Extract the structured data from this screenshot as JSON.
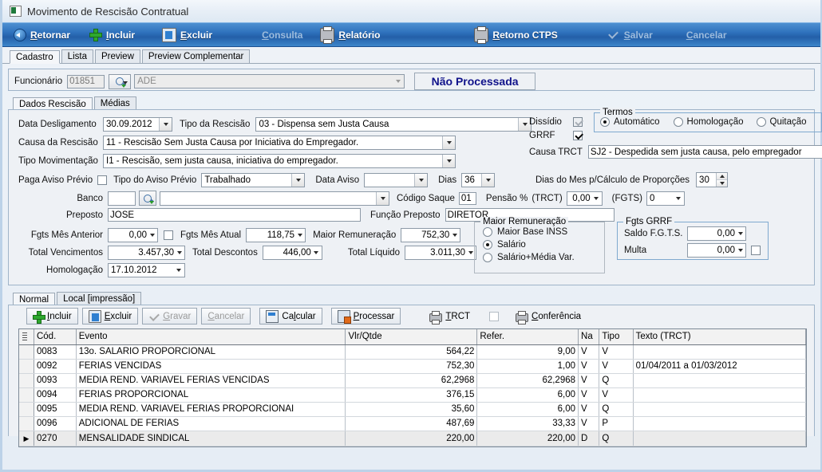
{
  "window": {
    "title": "Movimento de Rescisão Contratual",
    "icon": "window-icon"
  },
  "toolbar": [
    {
      "label": "Retornar",
      "accel": "R",
      "icon": "back-arrow-icon",
      "disabled": false
    },
    {
      "label": "Incluir",
      "accel": "I",
      "icon": "plus-icon",
      "disabled": false
    },
    {
      "label": "Excluir",
      "accel": "E",
      "icon": "delete-clipboard-icon",
      "disabled": false
    },
    {
      "label": "Consulta",
      "accel": "C",
      "icon": "none",
      "disabled": true
    },
    {
      "label": "Relatório",
      "accel": "R",
      "icon": "printer-icon",
      "disabled": false
    },
    {
      "label": "Retorno CTPS",
      "accel": "R",
      "icon": "printer-icon",
      "disabled": false
    },
    {
      "label": "Salvar",
      "accel": "S",
      "icon": "check-icon",
      "disabled": true
    },
    {
      "label": "Cancelar",
      "accel": "C",
      "icon": "none",
      "disabled": true
    }
  ],
  "main_tabs": [
    {
      "label": "Cadastro",
      "active": true
    },
    {
      "label": "Lista",
      "active": false
    },
    {
      "label": "Preview",
      "active": false
    },
    {
      "label": "Preview Complementar",
      "active": false
    }
  ],
  "employee": {
    "label": "Funcionário",
    "code": "01851",
    "name": "ADE",
    "search_icon": "magnifier-icon",
    "status": "Não Processada"
  },
  "sub_tabs": [
    {
      "label": "Dados Rescisão",
      "active": true
    },
    {
      "label": "Médias",
      "active": false
    }
  ],
  "form": {
    "data_desligamento_label": "Data Desligamento",
    "data_desligamento": "30.09.2012",
    "tipo_rescisao_label": "Tipo da Rescisão",
    "tipo_rescisao": "03 - Dispensa sem Justa Causa",
    "causa_rescisao_label": "Causa da Rescisão",
    "causa_rescisao": "11 - Rescisão Sem Justa Causa por Iniciativa do Empregador.",
    "tipo_movimentacao_label": "Tipo Movimentação",
    "tipo_movimentacao": "I1 - Rescisão, sem justa causa, iniciativa do empregador.",
    "paga_aviso_previo_label": "Paga Aviso Prévio",
    "paga_aviso_previo_checked": false,
    "tipo_aviso_previo_label": "Tipo do Aviso Prévio",
    "tipo_aviso_previo": "Trabalhado",
    "data_aviso_label": "Data Aviso",
    "data_aviso": "",
    "dias_label": "Dias",
    "dias": "36",
    "banco_label": "Banco",
    "banco_code": "",
    "banco_name": "",
    "banco_search_icon": "magnifier-icon",
    "codigo_saque_label": "Código Saque",
    "codigo_saque": "01",
    "pensao_label": "Pensão %",
    "pensao_trct_label": "(TRCT)",
    "pensao_trct": "0,00",
    "pensao_fgts_label": "(FGTS)",
    "pensao_fgts": "0",
    "preposto_label": "Preposto",
    "preposto": "JOSE",
    "funcao_preposto_label": "Função Preposto",
    "funcao_preposto": "DIRETOR",
    "fgts_mes_anterior_label": "Fgts Mês Anterior",
    "fgts_mes_anterior": "0,00",
    "fgts_mes_anterior_checked": false,
    "fgts_mes_atual_label": "Fgts Mês Atual",
    "fgts_mes_atual": "118,75",
    "maior_remuneracao_label": "Maior Remuneração",
    "maior_remuneracao": "752,30",
    "total_vencimentos_label": "Total Vencimentos",
    "total_vencimentos": "3.457,30",
    "total_descontos_label": "Total Descontos",
    "total_descontos": "446,00",
    "total_liquido_label": "Total Líquido",
    "total_liquido": "3.011,30",
    "homologacao_label": "Homologação",
    "homologacao": "17.10.2012",
    "dissidio_label": "Dissídio",
    "dissidio_checked": true,
    "dissidio_disabled": true,
    "grrf_label": "GRRF",
    "grrf_checked": true,
    "causa_trct_label": "Causa TRCT",
    "causa_trct": "SJ2 - Despedida sem justa causa, pelo empregador",
    "dias_mes_label": "Dias do Mes p/Cálculo de Proporções",
    "dias_mes": "30"
  },
  "termos": {
    "caption": "Termos",
    "options": [
      {
        "label": "Automático",
        "selected": true
      },
      {
        "label": "Homologação",
        "selected": false
      },
      {
        "label": "Quitação",
        "selected": false
      }
    ]
  },
  "maior_remuneracao_group": {
    "caption": "Maior Remuneração",
    "options": [
      {
        "label": "Maior Base INSS",
        "selected": false
      },
      {
        "label": "Salário",
        "selected": true
      },
      {
        "label": "Salário+Média Var.",
        "selected": false
      }
    ]
  },
  "fgts_grrf": {
    "caption": "Fgts GRRF",
    "saldo_label": "Saldo F.G.T.S.",
    "saldo": "0,00",
    "multa_label": "Multa",
    "multa": "0,00",
    "multa_checked": false
  },
  "bottom_tabs": [
    {
      "label": "Normal",
      "active": true
    },
    {
      "label": "Local [impressão]",
      "active": false
    }
  ],
  "bottom_buttons": [
    {
      "label": "Incluir",
      "accel": "I",
      "icon": "plus-icon",
      "disabled": false,
      "flat": false
    },
    {
      "label": "Excluir",
      "accel": "E",
      "icon": "delete-clipboard-icon",
      "disabled": false,
      "flat": false
    },
    {
      "label": "Gravar",
      "accel": "G",
      "icon": "check-icon",
      "disabled": true,
      "flat": false
    },
    {
      "label": "Cancelar",
      "accel": "C",
      "icon": "none",
      "disabled": true,
      "flat": false
    },
    {
      "label": "Calcular",
      "accel": "l",
      "icon": "calculator-icon",
      "disabled": false,
      "flat": false
    },
    {
      "label": "Processar",
      "accel": "P",
      "icon": "process-icon",
      "disabled": false,
      "flat": false
    },
    {
      "label": "TRCT",
      "accel": "T",
      "icon": "printer-icon",
      "disabled": false,
      "flat": true
    },
    {
      "label": "Conferência",
      "accel": "C",
      "icon": "printer-icon",
      "disabled": false,
      "flat": true
    }
  ],
  "bottom_checkbox_checked": false,
  "grid": {
    "columns": [
      "Cód.",
      "Evento",
      "Vlr/Qtde",
      "Refer.",
      "Na",
      "Tipo",
      "Texto (TRCT)"
    ],
    "rows": [
      {
        "cod": "0083",
        "evento": "13o. SALARIO PROPORCIONAL",
        "vlr": "564,22",
        "refer": "9,00",
        "na": "V",
        "tipo": "V",
        "texto": "",
        "selected": false
      },
      {
        "cod": "0092",
        "evento": "FERIAS VENCIDAS",
        "vlr": "752,30",
        "refer": "1,00",
        "na": "V",
        "tipo": "V",
        "texto": "01/04/2011 a 01/03/2012",
        "selected": false
      },
      {
        "cod": "0093",
        "evento": "MEDIA REND. VARIAVEL  FERIAS VENCIDAS",
        "vlr": "62,2968",
        "refer": "62,2968",
        "na": "V",
        "tipo": "Q",
        "texto": "",
        "selected": false
      },
      {
        "cod": "0094",
        "evento": "FERIAS PROPORCIONAL",
        "vlr": "376,15",
        "refer": "6,00",
        "na": "V",
        "tipo": "V",
        "texto": "",
        "selected": false
      },
      {
        "cod": "0095",
        "evento": "MEDIA REND. VARIAVEL FERIAS PROPORCIONAI",
        "vlr": "35,60",
        "refer": "6,00",
        "na": "V",
        "tipo": "Q",
        "texto": "",
        "selected": false
      },
      {
        "cod": "0096",
        "evento": "ADICIONAL DE FERIAS",
        "vlr": "487,69",
        "refer": "33,33",
        "na": "V",
        "tipo": "P",
        "texto": "",
        "selected": false
      },
      {
        "cod": "0270",
        "evento": "MENSALIDADE SINDICAL",
        "vlr": "220,00",
        "refer": "220,00",
        "na": "D",
        "tipo": "Q",
        "texto": "",
        "selected": true
      }
    ]
  }
}
